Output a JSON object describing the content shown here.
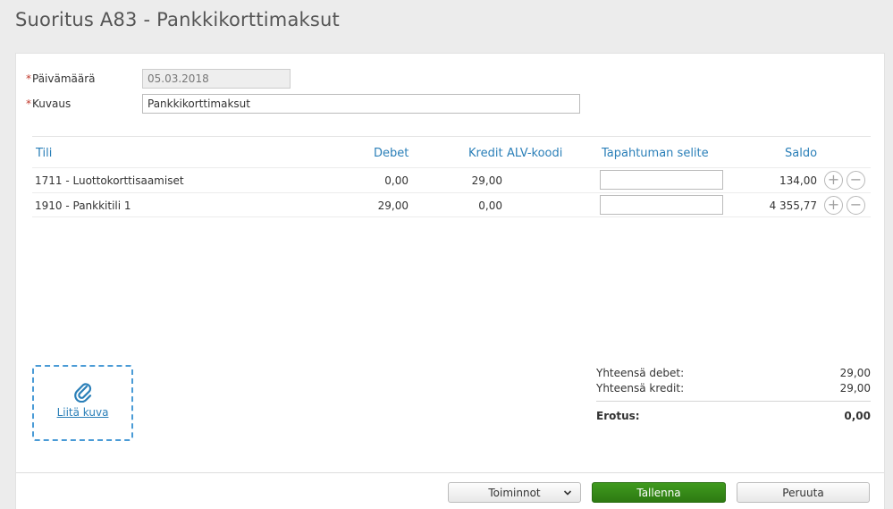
{
  "page": {
    "title": "Suoritus A83  -  Pankkikorttimaksut"
  },
  "form": {
    "date_label": "Päivämäärä",
    "date_value": "05.03.2018",
    "desc_label": "Kuvaus",
    "desc_value": "Pankkikorttimaksut",
    "required_mark": "*"
  },
  "grid": {
    "headers": {
      "account": "Tili",
      "debit": "Debet",
      "credit": "Kredit",
      "vat": "ALV-koodi",
      "explanation": "Tapahtuman selite",
      "balance": "Saldo"
    },
    "rows": [
      {
        "account": "1711 - Luottokorttisaamiset",
        "debit": "0,00",
        "credit": "29,00",
        "vat": "",
        "explanation": "",
        "balance": "134,00"
      },
      {
        "account": "1910 - Pankkitili 1",
        "debit": "29,00",
        "credit": "0,00",
        "vat": "",
        "explanation": "",
        "balance": "4 355,77"
      }
    ]
  },
  "attachment": {
    "link_label": "Liitä kuva",
    "icon": "paperclip-icon"
  },
  "totals": {
    "debit_label": "Yhteensä debet:",
    "debit_value": "29,00",
    "credit_label": "Yhteensä kredit:",
    "credit_value": "29,00",
    "diff_label": "Erotus:",
    "diff_value": "0,00"
  },
  "footer": {
    "actions_label": "Toiminnot",
    "save_label": "Tallenna",
    "cancel_label": "Peruuta"
  },
  "colors": {
    "accent": "#2a7fb8",
    "primary_button": "#2d7a12",
    "required": "#c0392b"
  }
}
